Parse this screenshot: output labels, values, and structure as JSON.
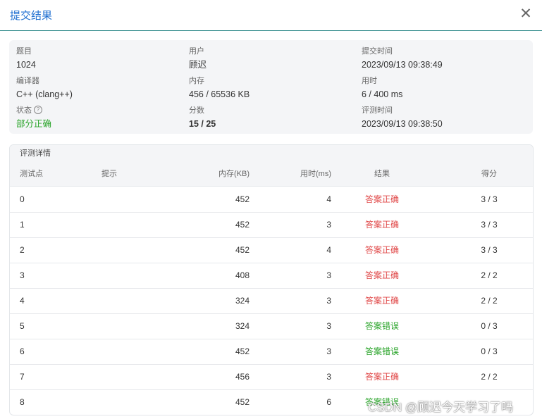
{
  "dialog": {
    "title": "提交结果",
    "close_symbol": "✕"
  },
  "summary": {
    "problem": {
      "label": "题目",
      "value": "1024"
    },
    "user": {
      "label": "用户",
      "value": "顾迟"
    },
    "submit_time": {
      "label": "提交时间",
      "value": "2023/09/13 09:38:49"
    },
    "compiler": {
      "label": "编译器",
      "value": "C++ (clang++)"
    },
    "memory": {
      "label": "内存",
      "value": "456 / 65536 KB"
    },
    "time": {
      "label": "用时",
      "value": "6 / 400 ms"
    },
    "status": {
      "label": "状态",
      "value": "部分正确",
      "help_glyph": "?"
    },
    "score": {
      "label": "分数",
      "value": "15 / 25"
    },
    "judge_time": {
      "label": "评测时间",
      "value": "2023/09/13 09:38:50"
    }
  },
  "details": {
    "title": "评测详情",
    "columns": {
      "id": "测试点",
      "hint": "提示",
      "mem": "内存(KB)",
      "time": "用时(ms)",
      "result": "结果",
      "score": "得分"
    },
    "rows": [
      {
        "id": "0",
        "hint": "",
        "mem": "452",
        "time": "4",
        "result": "答案正确",
        "score": "3 / 3"
      },
      {
        "id": "1",
        "hint": "",
        "mem": "452",
        "time": "3",
        "result": "答案正确",
        "score": "3 / 3"
      },
      {
        "id": "2",
        "hint": "",
        "mem": "452",
        "time": "4",
        "result": "答案正确",
        "score": "3 / 3"
      },
      {
        "id": "3",
        "hint": "",
        "mem": "408",
        "time": "3",
        "result": "答案正确",
        "score": "2 / 2"
      },
      {
        "id": "4",
        "hint": "",
        "mem": "324",
        "time": "3",
        "result": "答案正确",
        "score": "2 / 2"
      },
      {
        "id": "5",
        "hint": "",
        "mem": "324",
        "time": "3",
        "result": "答案错误",
        "score": "0 / 3"
      },
      {
        "id": "6",
        "hint": "",
        "mem": "452",
        "time": "3",
        "result": "答案错误",
        "score": "0 / 3"
      },
      {
        "id": "7",
        "hint": "",
        "mem": "456",
        "time": "3",
        "result": "答案正确",
        "score": "2 / 2"
      },
      {
        "id": "8",
        "hint": "",
        "mem": "452",
        "time": "6",
        "result": "答案错误",
        "score": ""
      }
    ]
  },
  "colors": {
    "accent": "#1f6fd0",
    "correct": "#e04848",
    "wrong": "#27a327",
    "partial": "#27a327"
  },
  "watermark": "CSDN @顾迟今天学习了吗"
}
